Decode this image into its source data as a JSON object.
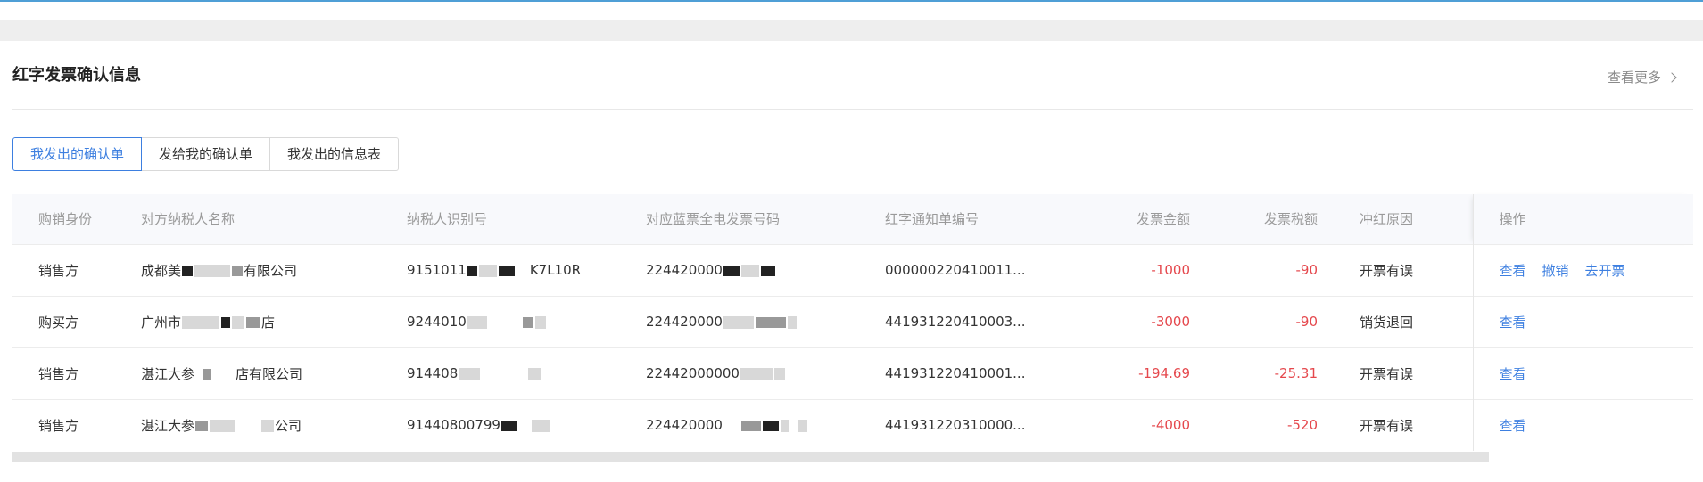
{
  "card": {
    "title": "红字发票确认信息",
    "view_more": "查看更多"
  },
  "tabs": [
    {
      "label": "我发出的确认单",
      "active": true
    },
    {
      "label": "发给我的确认单",
      "active": false
    },
    {
      "label": "我发出的信息表",
      "active": false
    }
  ],
  "table": {
    "headers": {
      "role": "购销身份",
      "counterparty": "对方纳税人名称",
      "tax_id": "纳税人识别号",
      "blue_invoice": "对应蓝票全电发票号码",
      "red_notice": "红字通知单编号",
      "amount": "发票金额",
      "tax": "发票税额",
      "reason": "冲红原因",
      "ops": "操作"
    },
    "rows": [
      {
        "role": "销售方",
        "counterparty_a": "成都美",
        "counterparty_b": "有限公司",
        "tax_id_a": "9151011",
        "tax_id_b": "K7L10R",
        "blue_invoice": "224420000",
        "red_notice": "000000220410011...",
        "amount": "-1000",
        "tax": "-90",
        "reason": "开票有误",
        "ops": [
          "查看",
          "撤销",
          "去开票"
        ]
      },
      {
        "role": "购买方",
        "counterparty_a": "广州市",
        "counterparty_b": "店",
        "tax_id_a": "9244010",
        "tax_id_b": "",
        "blue_invoice": "224420000",
        "red_notice": "441931220410003...",
        "amount": "-3000",
        "tax": "-90",
        "reason": "销货退回",
        "ops": [
          "查看"
        ]
      },
      {
        "role": "销售方",
        "counterparty_a": "湛江大参",
        "counterparty_b": "店有限公司",
        "tax_id_a": "914408",
        "tax_id_b": "",
        "blue_invoice": "22442000000",
        "red_notice": "441931220410001...",
        "amount": "-194.69",
        "tax": "-25.31",
        "reason": "开票有误",
        "ops": [
          "查看"
        ]
      },
      {
        "role": "销售方",
        "counterparty_a": "湛江大参",
        "counterparty_b": "公司",
        "tax_id_a": "91440800799",
        "tax_id_b": "",
        "blue_invoice": "224420000",
        "red_notice": "441931220310000...",
        "amount": "-4000",
        "tax": "-520",
        "reason": "开票有误",
        "ops": [
          "查看"
        ]
      }
    ]
  },
  "colors": {
    "accent": "#3d7fe0",
    "negative": "#e5484d",
    "header_bg": "#f8f9fc"
  }
}
